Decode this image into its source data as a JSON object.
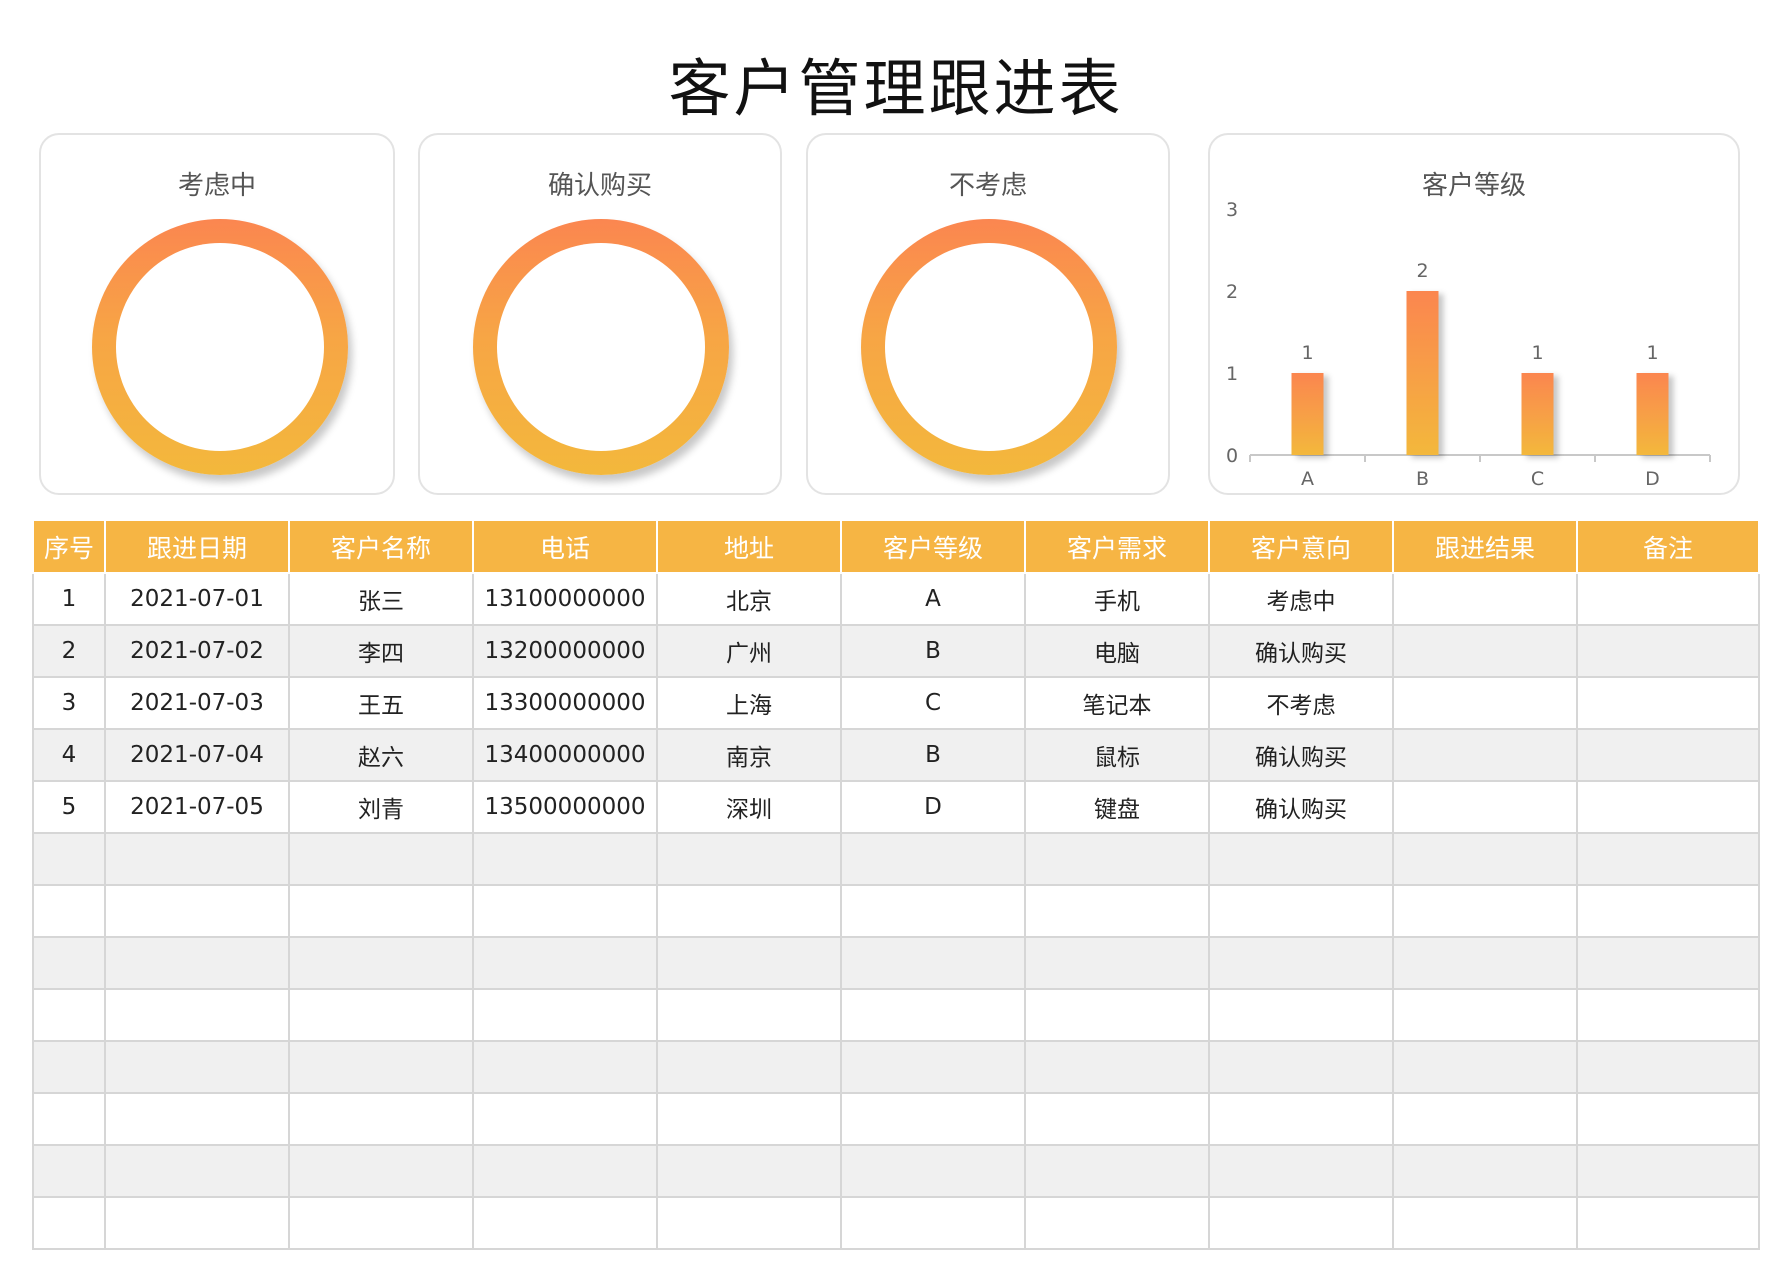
{
  "title": "客户管理跟进表",
  "donuts": [
    {
      "label": "考虑中"
    },
    {
      "label": "确认购买"
    },
    {
      "label": "不考虑"
    }
  ],
  "chart_data": {
    "type": "bar",
    "title": "客户等级",
    "categories": [
      "A",
      "B",
      "C",
      "D"
    ],
    "values": [
      1,
      2,
      1,
      1
    ],
    "ylim": [
      0,
      3
    ],
    "yticks": [
      "0",
      "1",
      "2",
      "3"
    ],
    "grid": false,
    "colors": {
      "top": "#fb8650",
      "bottom": "#f3b83c"
    }
  },
  "table": {
    "headers": [
      "序号",
      "跟进日期",
      "客户名称",
      "电话",
      "地址",
      "客户等级",
      "客户需求",
      "客户意向",
      "跟进结果",
      "备注"
    ],
    "rows": [
      [
        "1",
        "2021-07-01",
        "张三",
        "13100000000",
        "北京",
        "A",
        "手机",
        "考虑中",
        "",
        ""
      ],
      [
        "2",
        "2021-07-02",
        "李四",
        "13200000000",
        "广州",
        "B",
        "电脑",
        "确认购买",
        "",
        ""
      ],
      [
        "3",
        "2021-07-03",
        "王五",
        "13300000000",
        "上海",
        "C",
        "笔记本",
        "不考虑",
        "",
        ""
      ],
      [
        "4",
        "2021-07-04",
        "赵六",
        "13400000000",
        "南京",
        "B",
        "鼠标",
        "确认购买",
        "",
        ""
      ],
      [
        "5",
        "2021-07-05",
        "刘青",
        "13500000000",
        "深圳",
        "D",
        "键盘",
        "确认购买",
        "",
        ""
      ],
      [
        "",
        "",
        "",
        "",
        "",
        "",
        "",
        "",
        "",
        ""
      ],
      [
        "",
        "",
        "",
        "",
        "",
        "",
        "",
        "",
        "",
        ""
      ],
      [
        "",
        "",
        "",
        "",
        "",
        "",
        "",
        "",
        "",
        ""
      ],
      [
        "",
        "",
        "",
        "",
        "",
        "",
        "",
        "",
        "",
        ""
      ],
      [
        "",
        "",
        "",
        "",
        "",
        "",
        "",
        "",
        "",
        ""
      ],
      [
        "",
        "",
        "",
        "",
        "",
        "",
        "",
        "",
        "",
        ""
      ],
      [
        "",
        "",
        "",
        "",
        "",
        "",
        "",
        "",
        "",
        ""
      ],
      [
        "",
        "",
        "",
        "",
        "",
        "",
        "",
        "",
        "",
        ""
      ]
    ]
  },
  "colors": {
    "header_bg": "#f6b544",
    "ring_top": "#fb8650",
    "ring_bottom": "#f3b83c",
    "alt_row": "#f0f0f0"
  }
}
